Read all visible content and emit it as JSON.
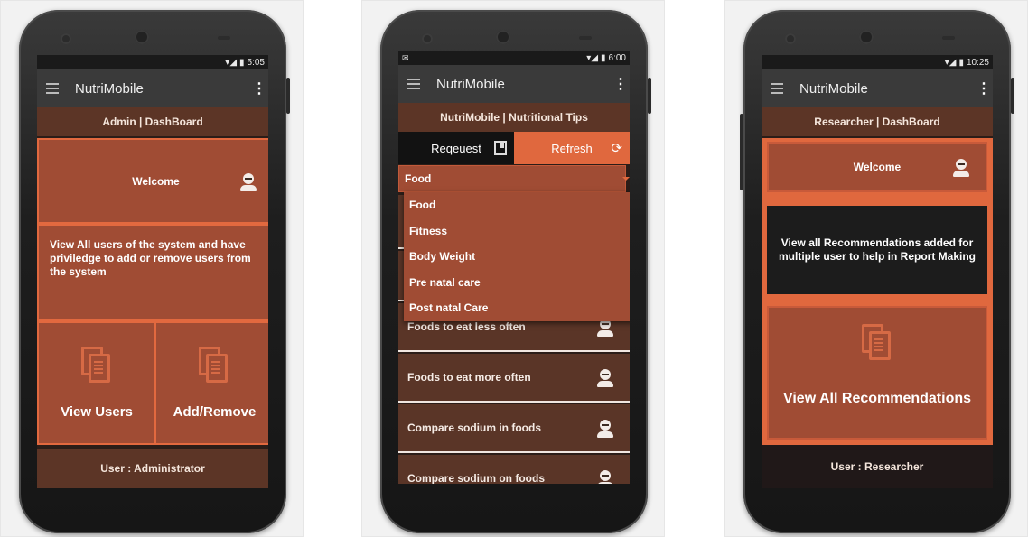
{
  "admin": {
    "status_time": "5:05",
    "app_title": "NutriMobile",
    "menu_glyph": "⋮",
    "dashboard_title": "Admin | DashBoard",
    "welcome_label": "Welcome",
    "description": "View All users of the system and have priviledge to add or remove users from the system",
    "view_users_label": "View Users",
    "add_remove_label": "Add/Remove",
    "footer": "User : Administrator"
  },
  "tips": {
    "status_time": "6:00",
    "app_title": "NutriMobile",
    "menu_glyph": "⋮",
    "header_title": "NutriMobile | Nutritional Tips",
    "tab_request": "Reqeuest",
    "tab_refresh": "Refresh",
    "refresh_glyph": "⟳",
    "selected": "Food",
    "dropdown_options": [
      "Food",
      "Fitness",
      "Body Weight",
      "Pre natal care",
      "Post natal Care"
    ],
    "list_items": [
      "Foods to eat less often",
      "Foods to eat more often",
      "Compare sodium in foods",
      "Compare sodium on foods"
    ]
  },
  "researcher": {
    "status_time": "10:25",
    "app_title": "NutriMobile",
    "menu_glyph": "⋮",
    "dashboard_title": "Researcher | DashBoard",
    "welcome_label": "Welcome",
    "description": "View all Recommendations added for multiple user to help in Report Making",
    "view_all_label": "View All Recommendations",
    "footer": "User : Researcher"
  },
  "colors": {
    "accent": "#e0683e",
    "panel": "#a04c34",
    "header": "#5c3526",
    "appbar": "#3a3a3a"
  }
}
